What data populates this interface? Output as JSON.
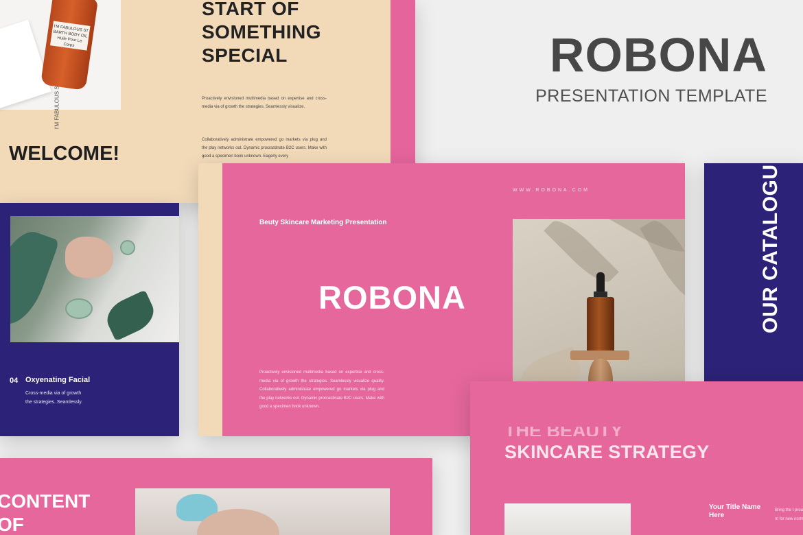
{
  "hero": {
    "title": "ROBONA",
    "subtitle": "PRESENTATION TEMPLATE"
  },
  "slide_welcome": {
    "heading_line1": "START OF",
    "heading_line2": "SOMETHING",
    "heading_line3": "SPECIAL",
    "para1": "Proactively envisioned multimedia based on  expertise and cross-media via of growth the strategies. Seamlessly visualize.",
    "para2": "Collaboratively administrate empowered go markets via plug and the play networks out. Dynamic procrastinate B2C users. Make with good a specimen book unknown.  Eagerly every",
    "welcome": "WELCOME!",
    "bottle_label": "I'M FABULOUS ST BARTH BODY OIL Huile Pour Le Corps",
    "box_label": "I'M FABULOUS ST BARTH BODY OIL Huile Pour Le Corps"
  },
  "slide_facial": {
    "number": "04",
    "title": "Oxyenating Facial",
    "description": "Cross-media via of growth the strategies. Seamlessly."
  },
  "slide_main": {
    "url": "WWW.ROBONA.COM",
    "tagline": "Beuty Skincare Marketing Presentation",
    "logo": "ROBONA",
    "body": "Proactively envisioned multimedia based on expertise and cross-media via of growth the strategies. Seamlessly visualize quality. Collaboratively administrate empowered go markets via plug and the play networks out. Dynamic procrastinate B2C users. Make with good a specimen book unknown."
  },
  "slide_catalogue": {
    "vertical_title": "OUR CATALOGUE"
  },
  "slide_strategy": {
    "cut_heading": "THE BEAUTY",
    "heading": "SKINCARE STRATEGY",
    "your_title": "Your Title Name Here",
    "body_text": "Bring the t proactive m for new norm"
  },
  "slide_content": {
    "heading_line1": "CONTENT",
    "heading_line2": "OF"
  },
  "colors": {
    "pink": "#e5679c",
    "navy": "#2c2277",
    "beige": "#f2dab9",
    "background": "#efefef"
  }
}
